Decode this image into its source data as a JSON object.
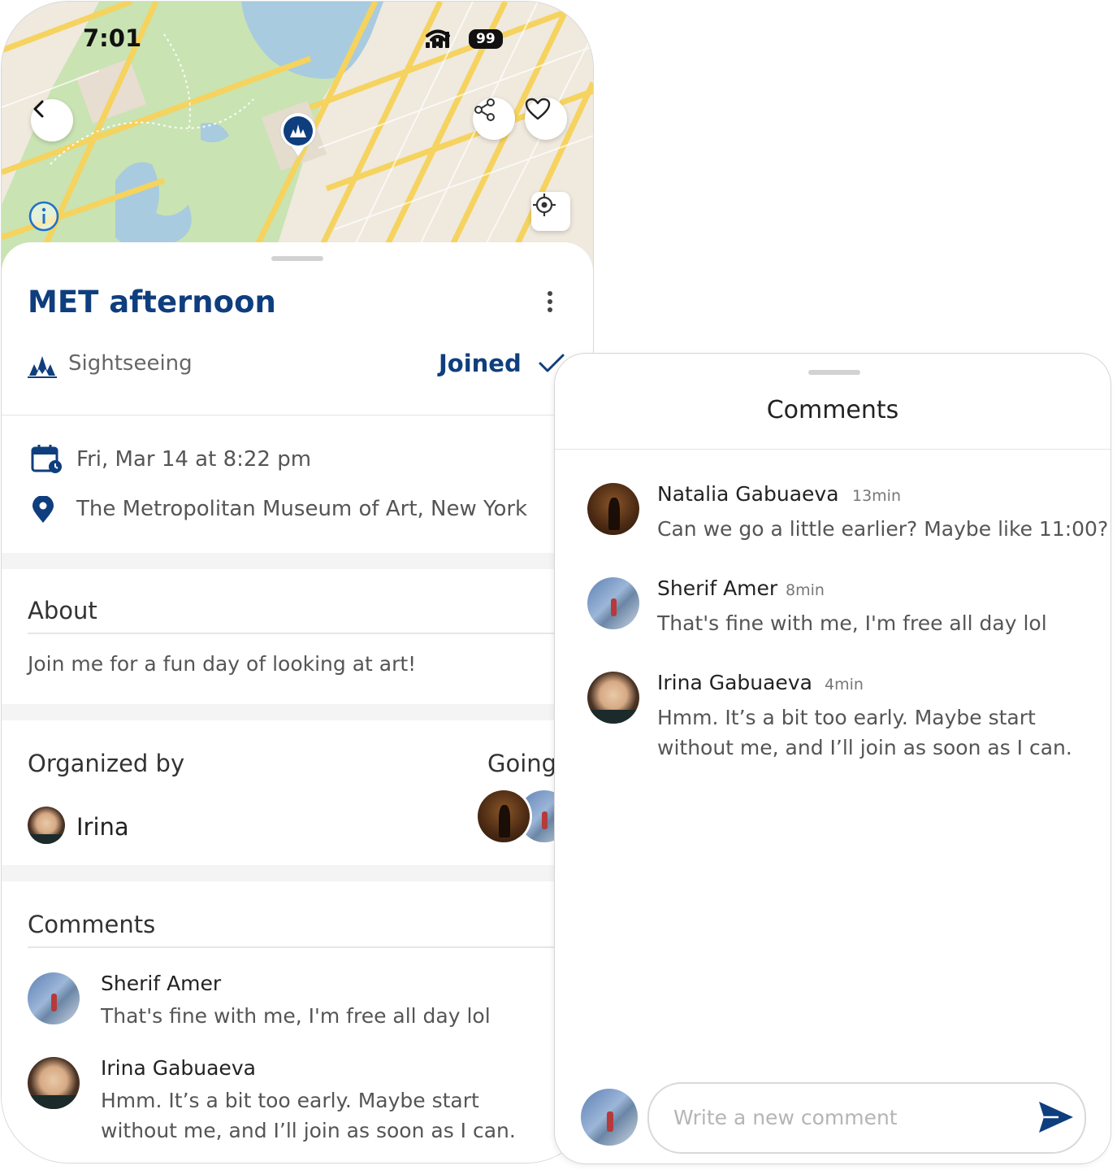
{
  "status_bar": {
    "time": "7:01",
    "battery": "99"
  },
  "event": {
    "title": "MET afternoon",
    "category": "Sightseeing",
    "join_status": "Joined",
    "datetime": "Fri, Mar 14 at 8:22 pm",
    "location": "The Metropolitan Museum of Art, New York"
  },
  "about": {
    "heading": "About",
    "text": "Join me for a fun day of looking at art!"
  },
  "organizer": {
    "heading": "Organized by",
    "name": "Irina",
    "going_label": "Going"
  },
  "comments_section": {
    "heading": "Comments",
    "items": [
      {
        "author": "Sherif Amer",
        "text": "That's fine with me, I'm free all day lol"
      },
      {
        "author": "Irina Gabuaeva",
        "text_lines": [
          "Hmm. It’s a bit too early. Maybe start",
          "without me, and I’ll join as soon as I can."
        ]
      }
    ]
  },
  "comments_panel": {
    "title": "Comments",
    "items": [
      {
        "author": "Natalia Gabuaeva",
        "time": "13min",
        "text": "Can we go a little earlier? Maybe like 11:00?"
      },
      {
        "author": "Sherif Amer",
        "time": "8min",
        "text": "That's fine with me, I'm free all day lol"
      },
      {
        "author": "Irina Gabuaeva",
        "time": "4min",
        "text_lines": [
          "Hmm. It’s a bit too early. Maybe start",
          "without me, and I’ll join as soon as I can."
        ]
      }
    ],
    "input_placeholder": "Write a new comment"
  },
  "colors": {
    "brand": "#0f3e7e",
    "map_water": "#a8cbe0",
    "map_park": "#c9e3b3",
    "map_road": "#f5d35e"
  },
  "icons": [
    "back-chevron-icon",
    "share-icon",
    "heart-icon",
    "info-icon",
    "locate-icon",
    "map-pin-icon",
    "category-icon",
    "check-icon",
    "calendar-icon",
    "location-pin-icon",
    "kebab-menu-icon",
    "send-icon"
  ]
}
